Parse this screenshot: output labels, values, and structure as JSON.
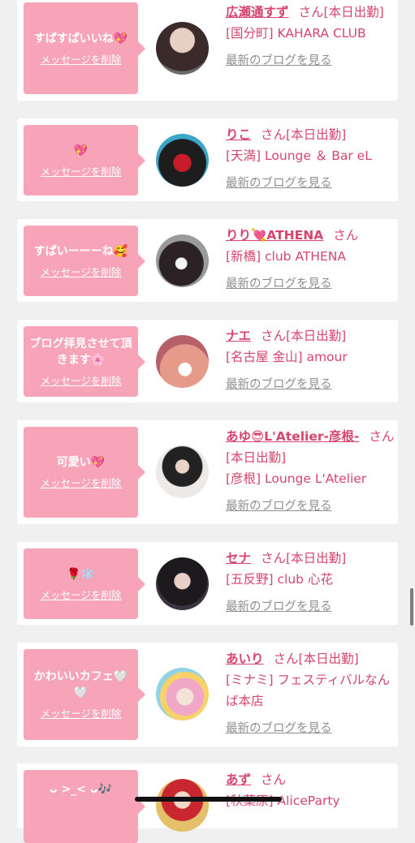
{
  "delete_label": "メッセージを削除",
  "blog_label": "最新のブログを見る",
  "cards": [
    {
      "message": "すぱすぱいいね💖",
      "name": "広瀬通すず",
      "san": "さん",
      "status": "[本日出勤]",
      "shop": "[国分町] KAHARA CLUB",
      "avatar_icon": "avatar-photo"
    },
    {
      "message": "💖",
      "name": "りこ",
      "san": "さん",
      "status": "[本日出勤]",
      "shop": "[天満] Lounge ＆ Bar eL",
      "avatar_icon": "avatar-photo"
    },
    {
      "message": "すぱいーーーね🥰",
      "name": "りり💘ATHENA",
      "san": "さん",
      "status": "",
      "shop": "[新橋] club ATHENA",
      "avatar_icon": "avatar-photo"
    },
    {
      "message": "ブログ拝見させて頂きます🌸",
      "name": "ナエ",
      "san": "さん",
      "status": "[本日出勤]",
      "shop": "[名古屋 金山] amour",
      "avatar_icon": "avatar-photo"
    },
    {
      "message": "可愛い💖",
      "name": "あゆ😎L'Atelier-彦根-",
      "san": "さん",
      "status": "[本日出勤]",
      "shop": "[彦根] Lounge L'Atelier",
      "avatar_icon": "avatar-photo"
    },
    {
      "message": "🌹❄️",
      "name": "セナ",
      "san": "さん",
      "status": "[本日出勤]",
      "shop": "[五反野] club 心花",
      "avatar_icon": "avatar-photo"
    },
    {
      "message": "かわいいカフェ🤍🤍",
      "name": "あいり",
      "san": "さん",
      "status": "[本日出勤]",
      "shop": "[ミナミ] フェスティバルなんば本店",
      "avatar_icon": "avatar-photo"
    },
    {
      "message": "ᴗ >_< ᴗ🎶",
      "name": "あず",
      "san": "さん",
      "status": "",
      "shop": "[秋葉原] AliceParty",
      "avatar_icon": "avatar-photo"
    }
  ],
  "colors": {
    "accent": "#d6456e",
    "bubble": "#f7a3b8",
    "background": "#f0f0f0"
  }
}
